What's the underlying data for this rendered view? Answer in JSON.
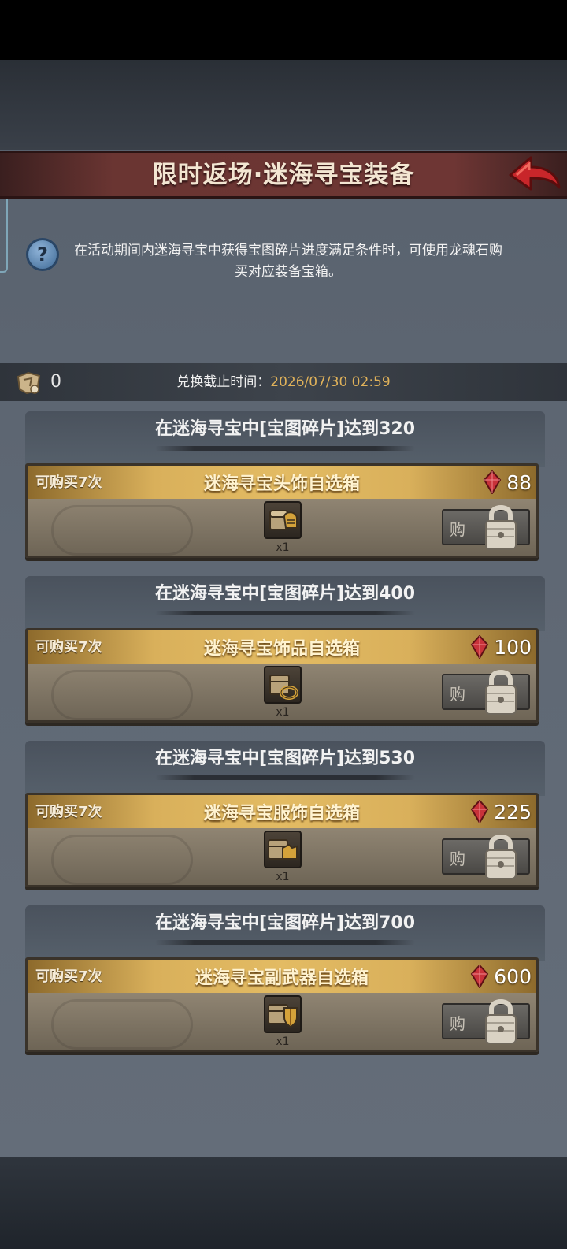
{
  "header": {
    "title": "限时返场·迷海寻宝装备"
  },
  "info": {
    "text": "在活动期间内迷海寻宝中获得宝图碎片进度满足条件时，可使用龙魂石购买对应装备宝箱。"
  },
  "status": {
    "map_fragments": "0",
    "deadline_label": "兑换截止时间：",
    "deadline_time": "2026/07/30 02:59"
  },
  "sections": [
    {
      "condition": "在迷海寻宝中[宝图碎片]达到320",
      "buy_limit": "可购买7次",
      "item_name": "迷海寻宝头饰自选箱",
      "price": "88",
      "qty": "x1",
      "buy_label": "购",
      "item_icon": "chest-helmet-icon"
    },
    {
      "condition": "在迷海寻宝中[宝图碎片]达到400",
      "buy_limit": "可购买7次",
      "item_name": "迷海寻宝饰品自选箱",
      "price": "100",
      "qty": "x1",
      "buy_label": "购",
      "item_icon": "chest-ring-icon"
    },
    {
      "condition": "在迷海寻宝中[宝图碎片]达到530",
      "buy_limit": "可购买7次",
      "item_name": "迷海寻宝服饰自选箱",
      "price": "225",
      "qty": "x1",
      "buy_label": "购",
      "item_icon": "chest-armor-icon"
    },
    {
      "condition": "在迷海寻宝中[宝图碎片]达到700",
      "buy_limit": "可购买7次",
      "item_name": "迷海寻宝副武器自选箱",
      "price": "600",
      "qty": "x1",
      "buy_label": "购",
      "item_icon": "chest-shield-icon"
    }
  ],
  "colors": {
    "title_bar": "#6e3634",
    "card_header_gold": "#e3bb63",
    "deadline_time": "#e0b25a",
    "gem_red": "#c8323a"
  }
}
